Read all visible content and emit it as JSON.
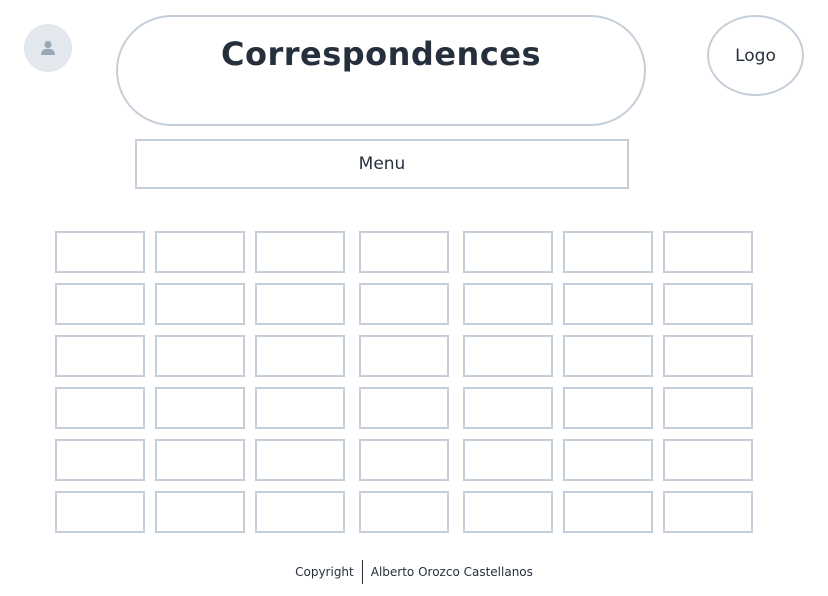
{
  "header": {
    "title": "Correspondences",
    "logo_label": "Logo",
    "avatar_icon": "user-icon"
  },
  "nav": {
    "menu_label": "Menu"
  },
  "grid": {
    "rows": 6,
    "columns": 7
  },
  "footer": {
    "copyright_label": "Copyright",
    "author": "Alberto Orozco Castellanos"
  },
  "colors": {
    "border": "#c5cfd9",
    "text": "#26303d",
    "avatar_bg": "#e3e8ee",
    "avatar_icon": "#9aa7b5"
  }
}
